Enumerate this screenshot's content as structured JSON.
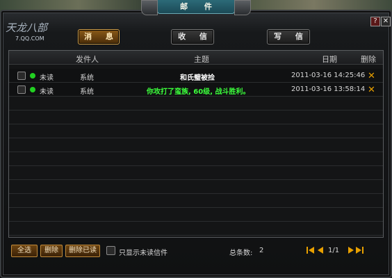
{
  "window": {
    "title": "邮 件"
  },
  "logo": {
    "text": "天龙八部",
    "site": "7.QQ.COM"
  },
  "top_buttons": {
    "help": "?",
    "close": "✕"
  },
  "tabs": [
    {
      "label": "消 息",
      "active": true
    },
    {
      "label": "收 信",
      "active": false
    },
    {
      "label": "写 信",
      "active": false
    }
  ],
  "table": {
    "headers": {
      "sender": "发件人",
      "subject": "主题",
      "date": "日期",
      "delete": "删除"
    },
    "rows": [
      {
        "status": "未读",
        "sender": "系统",
        "subject": "和氏璧被捡",
        "date": "2011-03-16 14:25:46",
        "subject_color": "#ffffff",
        "delete_icon": "✕"
      },
      {
        "status": "未读",
        "sender": "系统",
        "subject": "你攻打了蛮族, 60级, 战斗胜利。",
        "date": "2011-03-16 13:58:14",
        "subject_color": "#3cff3c",
        "delete_icon": "✕"
      }
    ],
    "empty_rows": 10
  },
  "footer": {
    "select_all": "全选",
    "delete": "删除",
    "delete_read": "删除已读",
    "unread_only_label": "只显示未读信件",
    "total_label": "总条数:",
    "total_value": "2",
    "page": "1/1"
  },
  "colors": {
    "accent_gold": "#d6a24a",
    "unread_dot": "#22d022",
    "delete_x": "#e8a000"
  }
}
